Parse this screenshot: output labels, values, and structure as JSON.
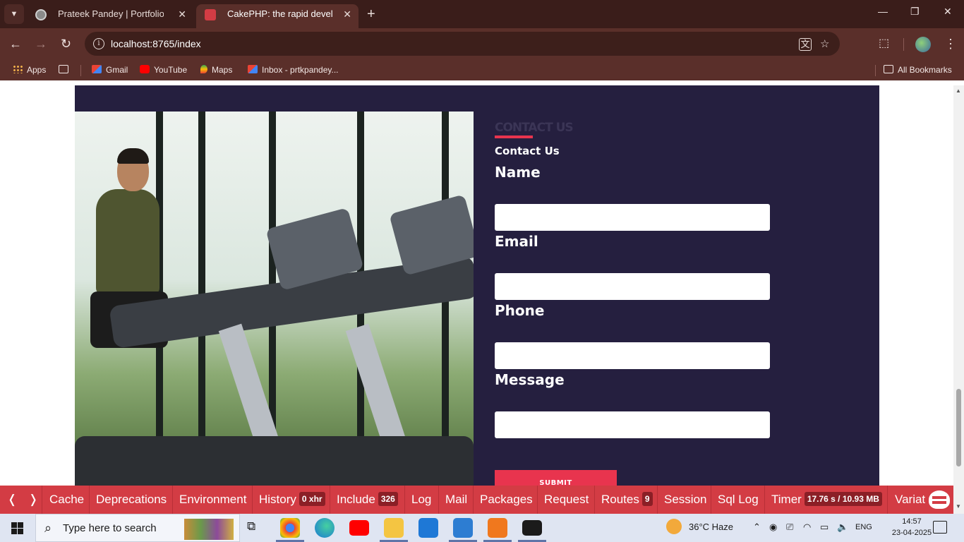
{
  "browser": {
    "tabs": [
      {
        "title": "Prateek Pandey | Portfolio",
        "close": "✕"
      },
      {
        "title": "CakePHP: the rapid development php framework",
        "close": "✕"
      }
    ],
    "new_tab": "+",
    "window_controls": {
      "minimize": "—",
      "restore": "❐",
      "close": "✕"
    },
    "nav": {
      "back": "←",
      "forward": "→",
      "reload": "↻"
    },
    "url": "localhost:8765/index",
    "bookmarks": [
      {
        "label": "Apps",
        "icon": "apps-grid-icon"
      },
      {
        "label": "Gmail",
        "icon": "gmail-icon"
      },
      {
        "label": "YouTube",
        "icon": "youtube-icon"
      },
      {
        "label": "Maps",
        "icon": "maps-icon"
      },
      {
        "label": "Inbox - prtkpandey...",
        "icon": "gmail-icon"
      }
    ],
    "all_bookmarks": "All Bookmarks"
  },
  "page": {
    "contact": {
      "kicker": "CONTACT US",
      "subtitle": "Contact Us",
      "fields": [
        {
          "label": "Name",
          "value": "",
          "placeholder": ""
        },
        {
          "label": "Email",
          "value": "",
          "placeholder": ""
        },
        {
          "label": "Phone",
          "value": "",
          "placeholder": ""
        },
        {
          "label": "Message",
          "value": "",
          "placeholder": ""
        }
      ],
      "submit_label": "SUBMIT"
    },
    "colors": {
      "section_bg": "#251f3f",
      "accent": "#e8344e"
    }
  },
  "debugkit": {
    "prev": "❬",
    "next": "❭",
    "items": [
      {
        "label": "Cache"
      },
      {
        "label": "Deprecations"
      },
      {
        "label": "Environment"
      },
      {
        "label": "History",
        "badge": "0 xhr"
      },
      {
        "label": "Include",
        "badge": "326"
      },
      {
        "label": "Log"
      },
      {
        "label": "Mail"
      },
      {
        "label": "Packages"
      },
      {
        "label": "Request"
      },
      {
        "label": "Routes",
        "badge": "9"
      },
      {
        "label": "Session"
      },
      {
        "label": "Sql Log"
      },
      {
        "label": "Timer",
        "badge": "17.76 s / 10.93 MB"
      },
      {
        "label": "Variat"
      }
    ],
    "color": "#d33c44"
  },
  "taskbar": {
    "search_placeholder": "Type here to search",
    "weather": "36°C  Haze",
    "language": "ENG",
    "time": "14:57",
    "date": "23-04-2025"
  }
}
